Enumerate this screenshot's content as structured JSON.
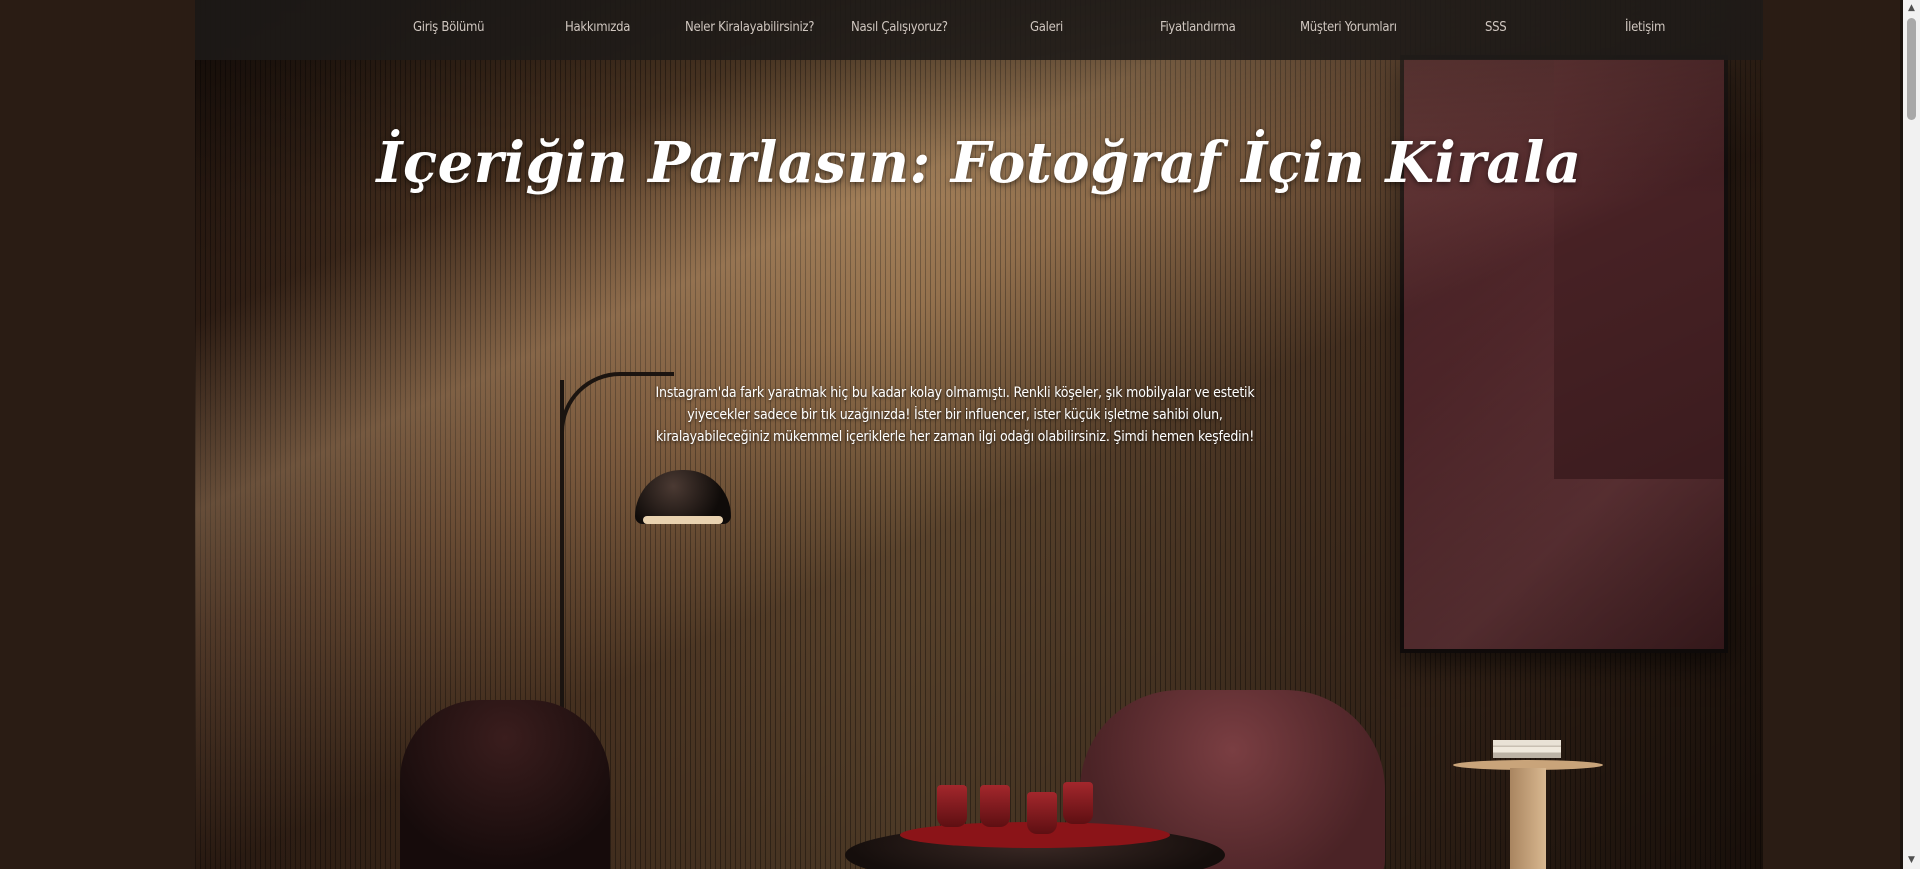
{
  "nav": {
    "items": [
      {
        "label": "Giriş Bölümü"
      },
      {
        "label": "Hakkımızda"
      },
      {
        "label": "Neler Kiralayabilirsiniz?"
      },
      {
        "label": "Nasıl Çalışıyoruz?"
      },
      {
        "label": "Galeri"
      },
      {
        "label": "Fiyatlandırma"
      },
      {
        "label": "Müşteri Yorumları"
      },
      {
        "label": "SSS"
      },
      {
        "label": "İletişim"
      }
    ]
  },
  "hero": {
    "title": "İçeriğin Parlasın: Fotoğraf İçin Kirala",
    "description": "Instagram'da fark yaratmak hiç bu kadar kolay olmamıştı. Renkli köşeler, şık mobilyalar ve estetik yiyecekler sadece bir tık uzağınızda! İster bir influencer, ister küçük işletme sahibi olun, kiralayabileceğiniz mükemmel içeriklerle her zaman ilgi odağı olabilirsiniz. Şimdi hemen keşfedin!"
  },
  "scrollbar": {
    "up_icon": "▲",
    "down_icon": "▼"
  },
  "colors": {
    "nav_background": "#1e1a18",
    "nav_text": "#cfc6bf",
    "hero_text": "#ffffff"
  }
}
